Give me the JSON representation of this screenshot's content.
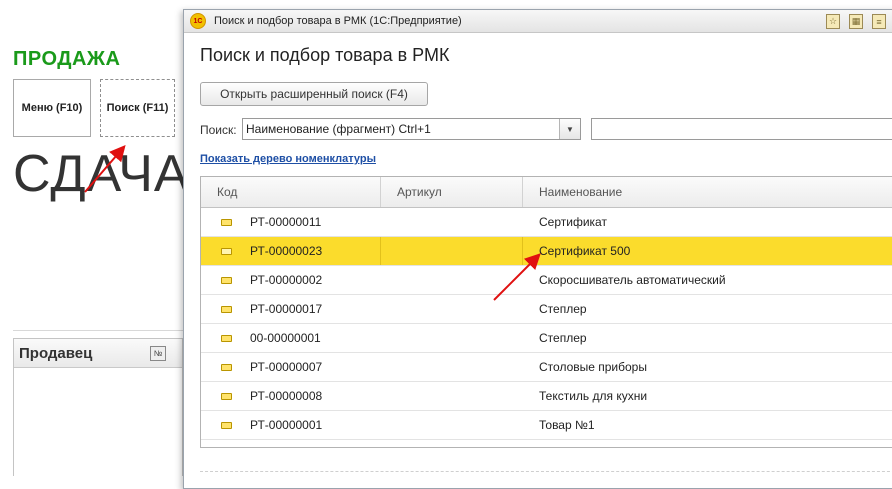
{
  "background": {
    "title": "ПРОДАЖА",
    "menu_button": "Меню (F10)",
    "search_button": "Поиск (F11)",
    "change_label": "СДАЧА",
    "seller_label": "Продавец",
    "seller_num_icon": "№"
  },
  "dialog": {
    "window_title": "Поиск и подбор товара в РМК  (1С:Предприятие)",
    "heading": "Поиск и подбор товара в РМК",
    "advanced_search_button": "Открыть расширенный поиск (F4)",
    "search_label": "Поиск:",
    "search_mode": "Наименование (фрагмент) Ctrl+1",
    "search_value": "",
    "tree_link": "Показать дерево номенклатуры",
    "columns": [
      "Код",
      "Артикул",
      "Наименование"
    ],
    "rows": [
      {
        "code": "РТ-00000011",
        "article": "",
        "name": "Сертификат"
      },
      {
        "code": "РТ-00000023",
        "article": "",
        "name": "Сертификат 500"
      },
      {
        "code": "РТ-00000002",
        "article": "",
        "name": "Скоросшиватель автоматический"
      },
      {
        "code": "РТ-00000017",
        "article": "",
        "name": "Степлер"
      },
      {
        "code": "00-00000001",
        "article": "",
        "name": "Степлер"
      },
      {
        "code": "РТ-00000007",
        "article": "",
        "name": "Столовые приборы"
      },
      {
        "code": "РТ-00000008",
        "article": "",
        "name": "Текстиль для кухни"
      },
      {
        "code": "РТ-00000001",
        "article": "",
        "name": "Товар №1"
      }
    ],
    "selected_row_index": 1
  },
  "colors": {
    "selection": "#fbdc2c",
    "title_green": "#1a9a1a",
    "link_blue": "#1e4fa5",
    "arrow_red": "#e01010"
  },
  "icons": [
    "app-1c-icon",
    "favorite-star-icon",
    "calculator-icon",
    "list-icon",
    "row-item-icon",
    "dropdown-arrow-icon"
  ]
}
